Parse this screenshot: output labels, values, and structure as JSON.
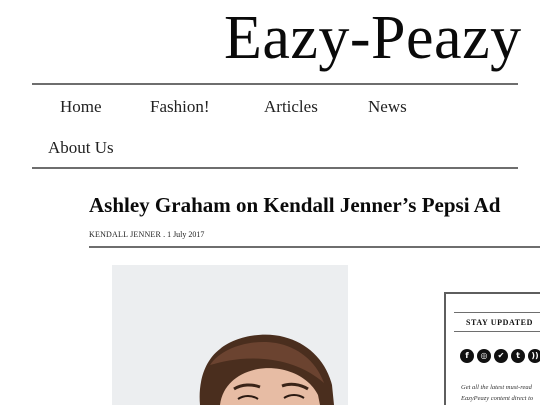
{
  "site": {
    "title": "Eazy-Peazy"
  },
  "nav": {
    "items": [
      {
        "label": "Home"
      },
      {
        "label": "Fashion!"
      },
      {
        "label": "Articles"
      },
      {
        "label": "News"
      },
      {
        "label": "About Us"
      }
    ]
  },
  "article": {
    "headline": "Ashley Graham on Kendall Jenner’s Pepsi Ad",
    "author": "Kendall Jenner",
    "separator": " . ",
    "date": "1 July 2017"
  },
  "sidebar": {
    "title": "STAY UPDATED",
    "social_icons": [
      "facebook-icon",
      "instagram-icon",
      "twitter-icon",
      "tumblr-icon",
      "rss-icon"
    ],
    "text_line1": "Get all the latest must-read",
    "text_line2": "EazyPeazy content direct to"
  },
  "colors": {
    "rule": "#6e6e6e",
    "text": "#111111",
    "background": "#ffffff"
  }
}
